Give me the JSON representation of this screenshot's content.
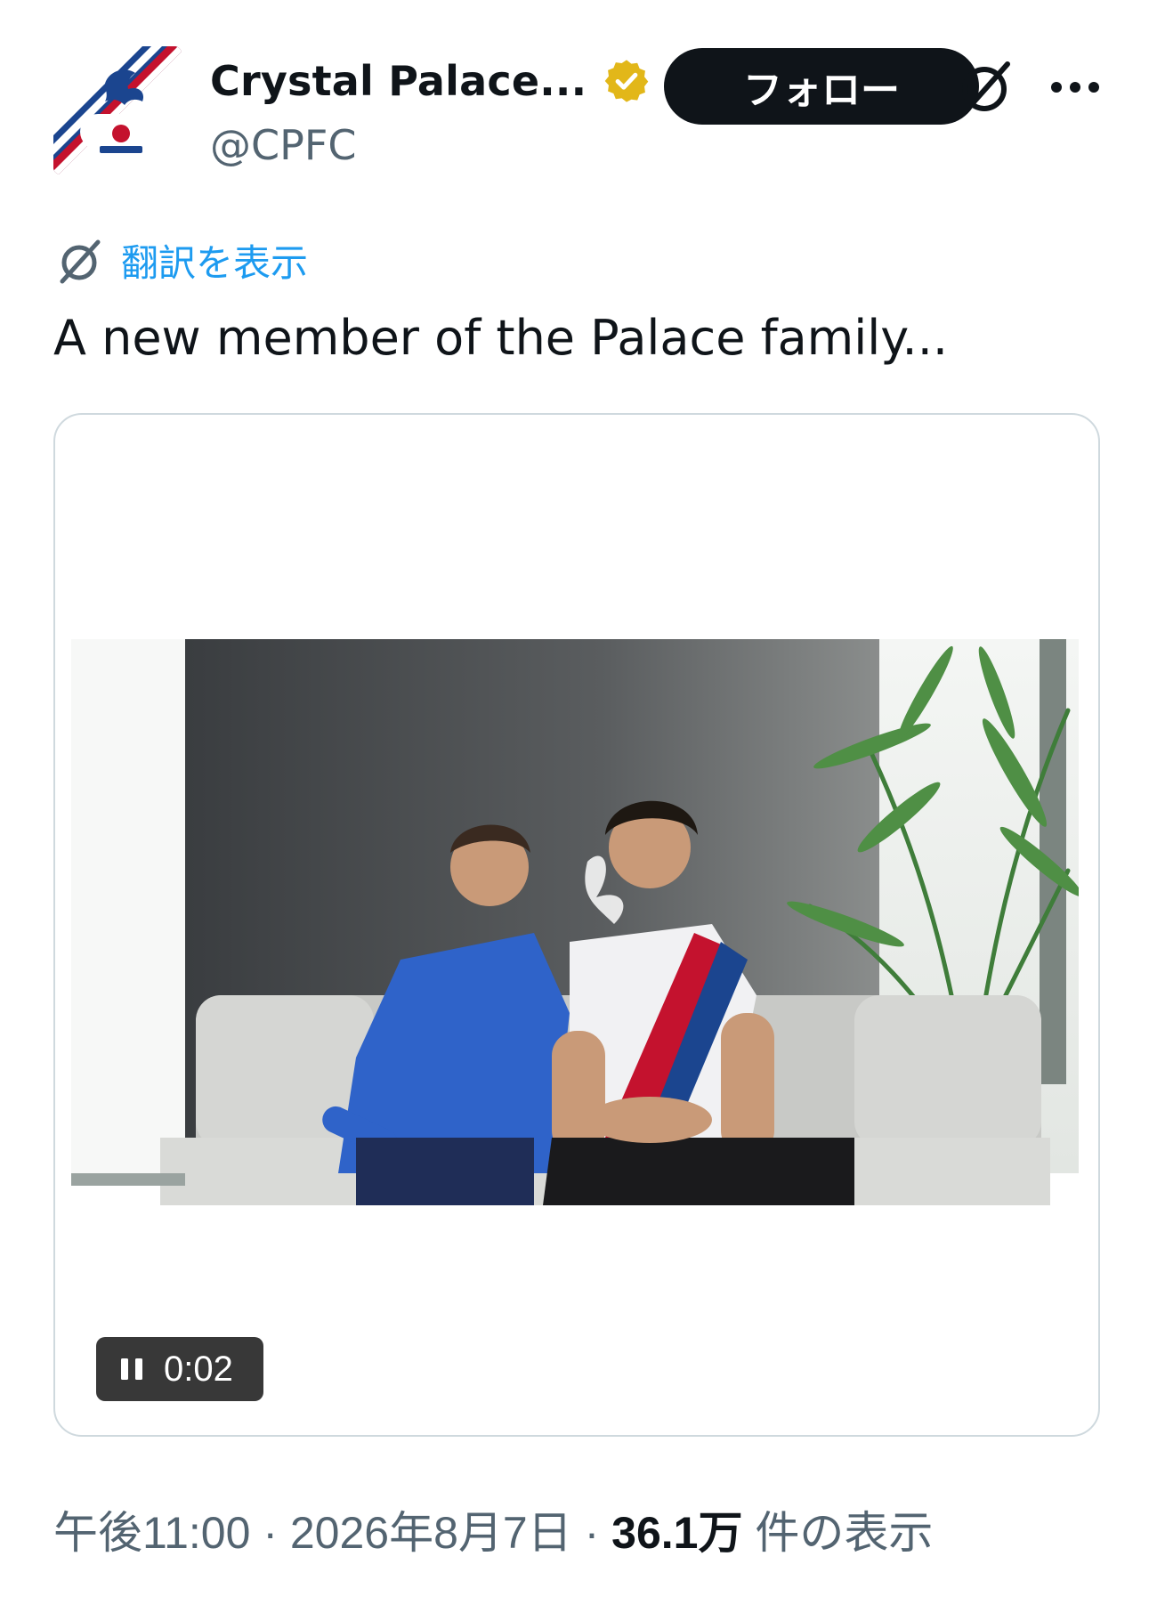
{
  "account": {
    "display_name": "Crystal Palace...",
    "handle": "@CPFC",
    "verified_badge": "gold-verified-badge-icon",
    "avatar": "crystal-palace-crest",
    "follow_label": "フォロー"
  },
  "actions": {
    "grok_icon": "grok-icon",
    "more_icon": "more-horizontal-icon"
  },
  "translate": {
    "icon": "grok-translate-icon",
    "label": "翻訳を表示"
  },
  "tweet": {
    "text": "A new member of the Palace family..."
  },
  "media": {
    "type": "video",
    "state": "playing",
    "elapsed": "0:02",
    "pause_icon": "pause-icon"
  },
  "meta": {
    "time": "午後11:00",
    "sep1": " · ",
    "date": "2026年8月7日",
    "sep2": " · ",
    "views_count": "36.1万",
    "views_suffix": " 件の表示"
  },
  "colors": {
    "accent_link": "#1d9bf0",
    "text_primary": "#0f1419",
    "text_secondary": "#536471",
    "follow_bg": "#0f1419",
    "verified_gold": "#e2b719",
    "border": "#cfd9de"
  }
}
